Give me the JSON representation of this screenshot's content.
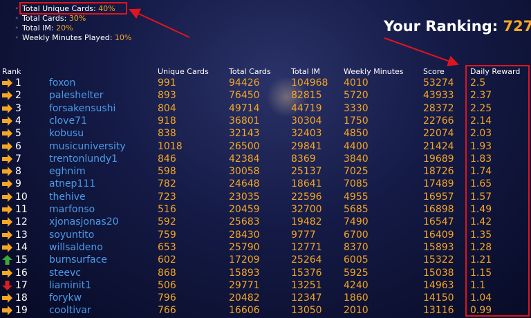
{
  "weights": [
    {
      "label": "Total Unique Cards:",
      "value": "40%"
    },
    {
      "label": "Total Cards:",
      "value": "30%"
    },
    {
      "label": "Total IM:",
      "value": "20%"
    },
    {
      "label": "Weekly Minutes Played:",
      "value": "10%"
    }
  ],
  "ranking": {
    "label": "Your Ranking:",
    "value": "727"
  },
  "headers": {
    "rank": "Rank",
    "unique_cards": "Unique Cards",
    "total_cards": "Total Cards",
    "total_im": "Total IM",
    "weekly_minutes": "Weekly Minutes",
    "score": "Score",
    "daily_reward": "Daily Reward"
  },
  "colors": {
    "accent": "#f5a623",
    "name": "#4a9bea",
    "highlight": "#e0141f",
    "up": "#3aa83a",
    "down": "#d42020"
  },
  "rows": [
    {
      "rank": "1",
      "trend": "right",
      "name": "foxon",
      "unique": "991",
      "cards": "94426",
      "im": "104968",
      "minutes": "4010",
      "score": "53274",
      "reward": "2.5"
    },
    {
      "rank": "2",
      "trend": "right",
      "name": "paleshelter",
      "unique": "893",
      "cards": "76450",
      "im": "82815",
      "minutes": "5720",
      "score": "43933",
      "reward": "2.37"
    },
    {
      "rank": "3",
      "trend": "right",
      "name": "forsakensushi",
      "unique": "804",
      "cards": "49714",
      "im": "44719",
      "minutes": "3330",
      "score": "28372",
      "reward": "2.25"
    },
    {
      "rank": "4",
      "trend": "right",
      "name": "clove71",
      "unique": "918",
      "cards": "36801",
      "im": "30304",
      "minutes": "1750",
      "score": "22766",
      "reward": "2.14"
    },
    {
      "rank": "5",
      "trend": "right",
      "name": "kobusu",
      "unique": "838",
      "cards": "32143",
      "im": "32403",
      "minutes": "4850",
      "score": "22074",
      "reward": "2.03"
    },
    {
      "rank": "6",
      "trend": "right",
      "name": "musicuniversity",
      "unique": "1018",
      "cards": "26500",
      "im": "29841",
      "minutes": "4400",
      "score": "21424",
      "reward": "1.93"
    },
    {
      "rank": "7",
      "trend": "right",
      "name": "trentonlundy1",
      "unique": "846",
      "cards": "42384",
      "im": "8369",
      "minutes": "3840",
      "score": "19689",
      "reward": "1.83"
    },
    {
      "rank": "8",
      "trend": "right",
      "name": "eghnim",
      "unique": "598",
      "cards": "30058",
      "im": "25137",
      "minutes": "7025",
      "score": "18726",
      "reward": "1.74"
    },
    {
      "rank": "9",
      "trend": "right",
      "name": "atnep111",
      "unique": "782",
      "cards": "24648",
      "im": "18641",
      "minutes": "7085",
      "score": "17489",
      "reward": "1.65"
    },
    {
      "rank": "10",
      "trend": "right",
      "name": "thehive",
      "unique": "723",
      "cards": "23035",
      "im": "22596",
      "minutes": "4955",
      "score": "16957",
      "reward": "1.57"
    },
    {
      "rank": "11",
      "trend": "right",
      "name": "marfonso",
      "unique": "516",
      "cards": "20459",
      "im": "32700",
      "minutes": "5685",
      "score": "16898",
      "reward": "1.49"
    },
    {
      "rank": "12",
      "trend": "right",
      "name": "xjonasjonas20",
      "unique": "592",
      "cards": "25683",
      "im": "19482",
      "minutes": "7490",
      "score": "16547",
      "reward": "1.42"
    },
    {
      "rank": "13",
      "trend": "right",
      "name": "soyuntito",
      "unique": "759",
      "cards": "28430",
      "im": "9777",
      "minutes": "6700",
      "score": "16409",
      "reward": "1.35"
    },
    {
      "rank": "14",
      "trend": "right",
      "name": "willsaldeno",
      "unique": "653",
      "cards": "25790",
      "im": "12771",
      "minutes": "8370",
      "score": "15893",
      "reward": "1.28"
    },
    {
      "rank": "15",
      "trend": "up",
      "name": "burnsurface",
      "unique": "602",
      "cards": "17209",
      "im": "25264",
      "minutes": "6005",
      "score": "15322",
      "reward": "1.21"
    },
    {
      "rank": "16",
      "trend": "right",
      "name": "steevc",
      "unique": "868",
      "cards": "15893",
      "im": "15376",
      "minutes": "5925",
      "score": "15038",
      "reward": "1.15"
    },
    {
      "rank": "17",
      "trend": "down",
      "name": "liaminit1",
      "unique": "506",
      "cards": "29771",
      "im": "13251",
      "minutes": "4240",
      "score": "14963",
      "reward": "1.1"
    },
    {
      "rank": "18",
      "trend": "right",
      "name": "forykw",
      "unique": "796",
      "cards": "20482",
      "im": "12347",
      "minutes": "1860",
      "score": "14150",
      "reward": "1.04"
    },
    {
      "rank": "19",
      "trend": "right",
      "name": "cooltivar",
      "unique": "766",
      "cards": "16606",
      "im": "13050",
      "minutes": "2010",
      "score": "13116",
      "reward": "0.99"
    }
  ]
}
